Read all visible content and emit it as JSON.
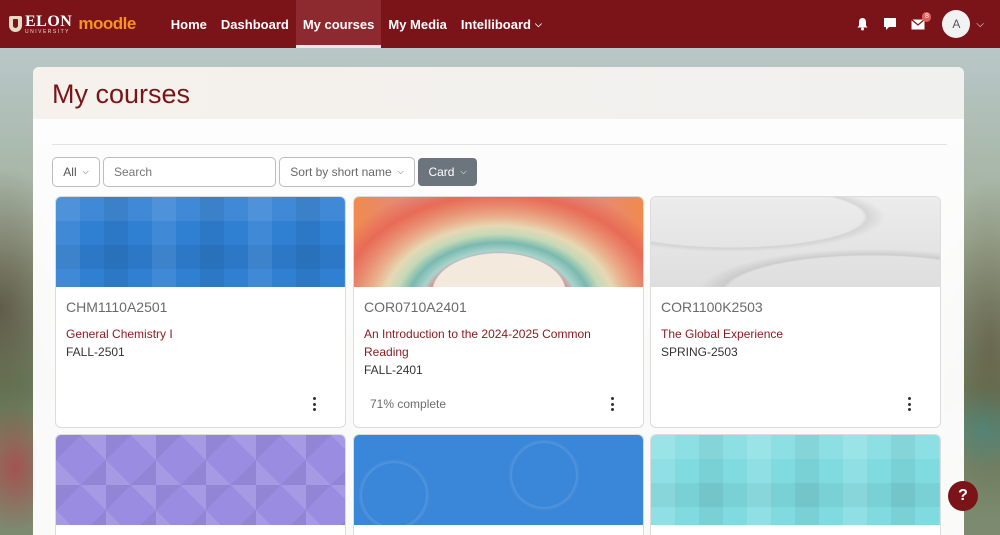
{
  "brand": {
    "elon": "ELON",
    "elon_sub": "UNIVERSITY",
    "moodle": "moodle"
  },
  "nav": {
    "items": [
      {
        "label": "Home"
      },
      {
        "label": "Dashboard"
      },
      {
        "label": "My courses",
        "active": true
      },
      {
        "label": "My Media"
      },
      {
        "label": "Intelliboard",
        "has_dropdown": true
      }
    ],
    "icons": [
      "bell-icon",
      "chat-icon",
      "envelope-icon"
    ],
    "envelope_badge": "8",
    "avatar_initial": "A"
  },
  "page": {
    "title": "My courses",
    "filters": {
      "grouping": "All",
      "search_placeholder": "Search",
      "sort": "Sort by short name",
      "view": "Card"
    }
  },
  "courses": [
    {
      "shortname": "CHM1110A2501",
      "fullname": "General Chemistry I",
      "term": "FALL-2501",
      "progress": ""
    },
    {
      "shortname": "COR0710A2401",
      "fullname": "An Introduction to the 2024-2025 Common Reading",
      "term": "FALL-2401",
      "progress": "71% complete"
    },
    {
      "shortname": "COR1100K2503",
      "fullname": "The Global Experience",
      "term": "SPRING-2503",
      "progress": ""
    }
  ],
  "help_label": "?",
  "colors": {
    "brand": "#7a1418",
    "link": "#8a1a1f",
    "view_button": "#6c757d"
  }
}
